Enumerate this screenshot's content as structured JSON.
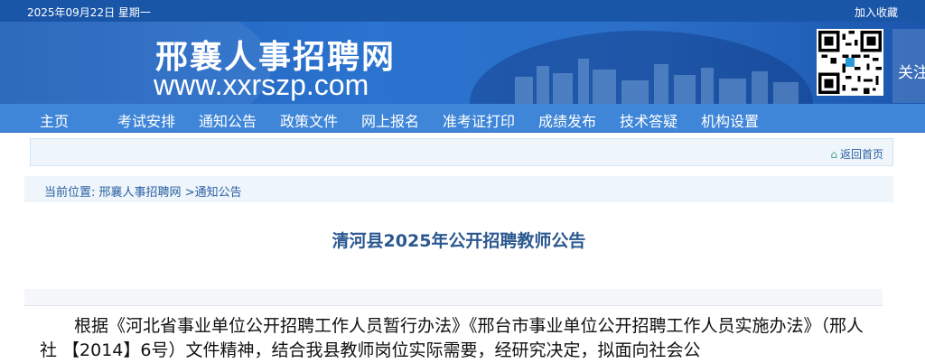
{
  "topbar": {
    "date": "2025年09月22日 星期一",
    "favorite": "加入收藏"
  },
  "banner": {
    "site_name": "邢襄人事招聘网",
    "site_url": "www.xxrszp.com",
    "follow_label": "关注"
  },
  "nav": {
    "items": [
      "主页",
      "考试安排",
      "通知公告",
      "政策文件",
      "网上报名",
      "准考证打印",
      "成绩发布",
      "技术答疑",
      "机构设置"
    ]
  },
  "homebar": {
    "return_home": "返回首页"
  },
  "breadcrumb": {
    "prefix": "当前位置:",
    "home": "邢襄人事招聘网",
    "separator": ">",
    "current": "通知公告"
  },
  "article": {
    "title": "清河县2025年公开招聘教师公告",
    "body": "根据《河北省事业单位公开招聘工作人员暂行办法》《邢台市事业单位公开招聘工作人员实施办法》（邢人社  【2014】6号）文件精神，结合我县教师岗位实际需要，经研究决定，拟面向社会公"
  },
  "colors": {
    "topbar": "#1a56a8",
    "nav": "#3f86d8",
    "title": "#2b5890",
    "link": "#2b5ea0"
  }
}
